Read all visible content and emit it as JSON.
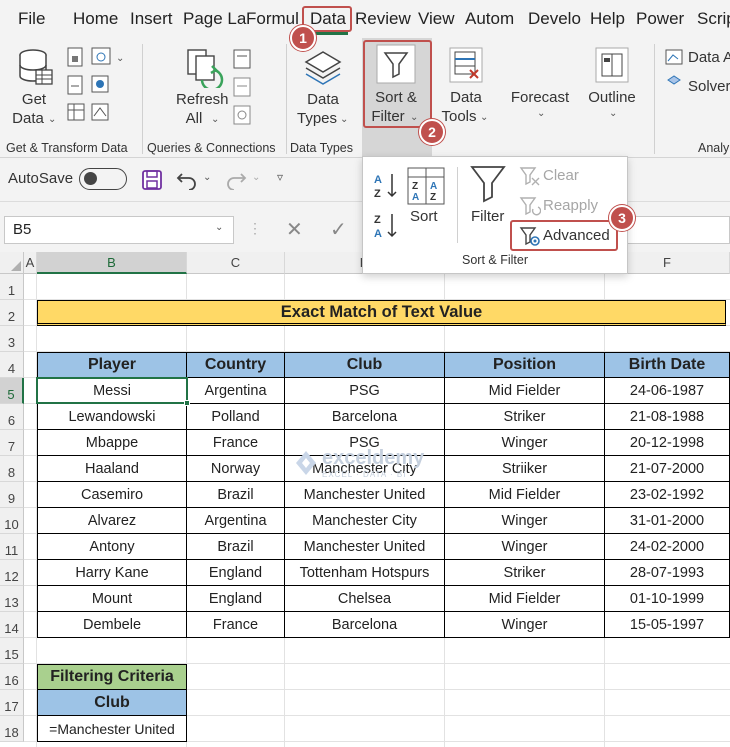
{
  "tabs": [
    "File",
    "Home",
    "Insert",
    "Page La",
    "Formul",
    "Data",
    "Review",
    "View",
    "Autom",
    "Develo",
    "Help",
    "Power",
    "Scrip"
  ],
  "ribbon": {
    "get_data": {
      "line1": "Get",
      "line2": "Data"
    },
    "refresh_all": {
      "line1": "Refresh",
      "line2": "All"
    },
    "data_types": {
      "line1": "Data",
      "line2": "Types"
    },
    "sort_filter": {
      "line1": "Sort &",
      "line2": "Filter"
    },
    "data_tools": {
      "line1": "Data",
      "line2": "Tools"
    },
    "forecast": "Forecast",
    "outline": "Outline",
    "data_analysis": "Data A",
    "solver": "Solver",
    "groups": {
      "get_transform": "Get & Transform Data",
      "queries": "Queries & Connections",
      "data_types": "Data Types",
      "analysis": "Analy"
    }
  },
  "qat": {
    "autosave": "AutoSave"
  },
  "formula_bar": {
    "name_box": "B5"
  },
  "dropdown": {
    "sort": "Sort",
    "filter": "Filter",
    "clear": "Clear",
    "reapply": "Reapply",
    "advanced": "Advanced",
    "group_label": "Sort & Filter"
  },
  "badges": [
    "1",
    "2",
    "3"
  ],
  "columns": [
    "A",
    "B",
    "C",
    "D",
    "E",
    "F"
  ],
  "rows": [
    "1",
    "2",
    "3",
    "4",
    "5",
    "6",
    "7",
    "8",
    "9",
    "10",
    "11",
    "12",
    "13",
    "14",
    "15",
    "16",
    "17",
    "18"
  ],
  "sheet": {
    "title": "Exact Match of Text Value",
    "headers": [
      "Player",
      "Country",
      "Club",
      "Position",
      "Birth Date"
    ],
    "data": [
      [
        "Messi",
        "Argentina",
        "PSG",
        "Mid Fielder",
        "24-06-1987"
      ],
      [
        "Lewandowski",
        "Polland",
        "Barcelona",
        "Striker",
        "21-08-1988"
      ],
      [
        "Mbappe",
        "France",
        "PSG",
        "Winger",
        "20-12-1998"
      ],
      [
        "Haaland",
        "Norway",
        "Manchester City",
        "Striiker",
        "21-07-2000"
      ],
      [
        "Casemiro",
        "Brazil",
        "Manchester United",
        "Mid Fielder",
        "23-02-1992"
      ],
      [
        "Alvarez",
        "Argentina",
        "Manchester City",
        "Winger",
        "31-01-2000"
      ],
      [
        "Antony",
        "Brazil",
        "Manchester United",
        "Winger",
        "24-02-2000"
      ],
      [
        "Harry Kane",
        "England",
        "Tottenham Hotspurs",
        "Striker",
        "28-07-1993"
      ],
      [
        "Mount",
        "England",
        "Chelsea",
        "Mid Fielder",
        "01-10-1999"
      ],
      [
        "Dembele",
        "France",
        "Barcelona",
        "Winger",
        "15-05-1997"
      ]
    ],
    "criteria": {
      "title": "Filtering Criteria",
      "header": "Club",
      "value": "=Manchester United"
    }
  },
  "watermark": {
    "name": "exceldemy",
    "tagline": "EXCEL · DATA · BI"
  },
  "colors": {
    "header_fill": "#9dc3e6",
    "title_fill": "#ffd966",
    "criteria_fill": "#a9d08e",
    "badge": "#c0504d",
    "excel_green": "#217346"
  }
}
